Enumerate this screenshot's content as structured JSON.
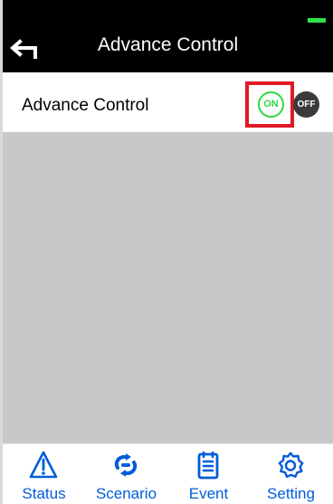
{
  "header": {
    "title": "Advance Control",
    "back_icon": "back-arrow-icon",
    "battery_color": "#2ee24a"
  },
  "control": {
    "label": "Advance Control",
    "on_label": "ON",
    "off_label": "OFF",
    "selected": "ON",
    "on_color": "#31d741",
    "off_color": "#3b3b3b",
    "highlight_color": "#e01a26"
  },
  "content": {
    "background": "#c8c8c8"
  },
  "bottom_nav": {
    "accent": "#005cd9",
    "items": [
      {
        "label": "Status",
        "icon": "warning-triangle-icon"
      },
      {
        "label": "Scenario",
        "icon": "scenario-icon"
      },
      {
        "label": "Event",
        "icon": "event-calendar-icon"
      },
      {
        "label": "Setting",
        "icon": "gear-icon"
      }
    ]
  }
}
